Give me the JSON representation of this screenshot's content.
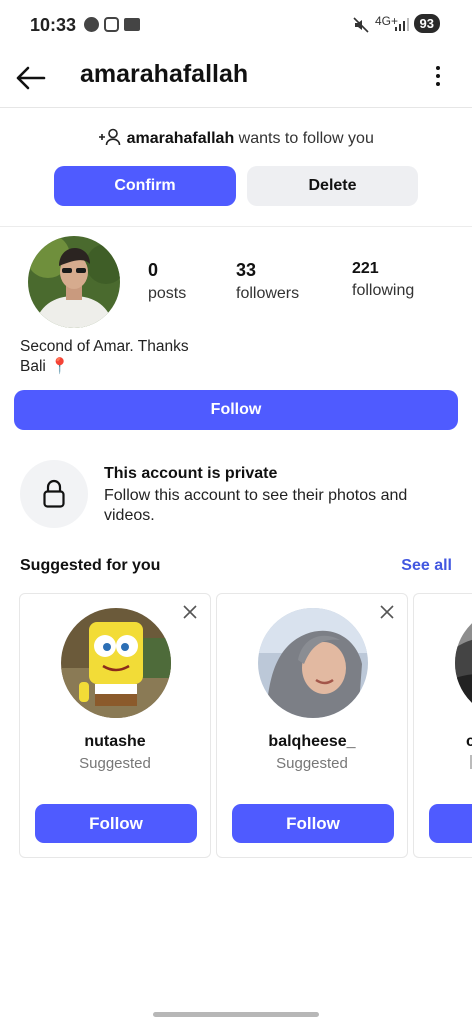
{
  "status_bar": {
    "time": "10:33",
    "network": "4G+",
    "battery": "93"
  },
  "header": {
    "username": "amarahafallah"
  },
  "follow_request": {
    "username": "amarahafallah",
    "message": " wants to follow you",
    "confirm_label": "Confirm",
    "delete_label": "Delete"
  },
  "profile": {
    "stats": [
      {
        "value": "0",
        "label": "posts"
      },
      {
        "value": "33",
        "label": "followers"
      },
      {
        "value": "221",
        "label": "following"
      }
    ],
    "bio_line1": "Second of Amar. Thanks",
    "bio_line2": "Bali 📍",
    "follow_label": "Follow"
  },
  "private_notice": {
    "title": "This account is private",
    "text": "Follow this account to see their photos and videos."
  },
  "suggestions": {
    "heading": "Suggested for you",
    "see_all_label": "See all",
    "cards": [
      {
        "name": "nutashe",
        "sub": "Suggested",
        "follow_label": "Follow"
      },
      {
        "name": "balqheese_",
        "sub": "Suggested",
        "follow_label": "Follow"
      },
      {
        "name": "c",
        "sub": "",
        "follow_label": ""
      }
    ]
  },
  "colors": {
    "accent": "#4f5bff",
    "link": "#4257e0",
    "secondary_button": "#eeeff2"
  }
}
